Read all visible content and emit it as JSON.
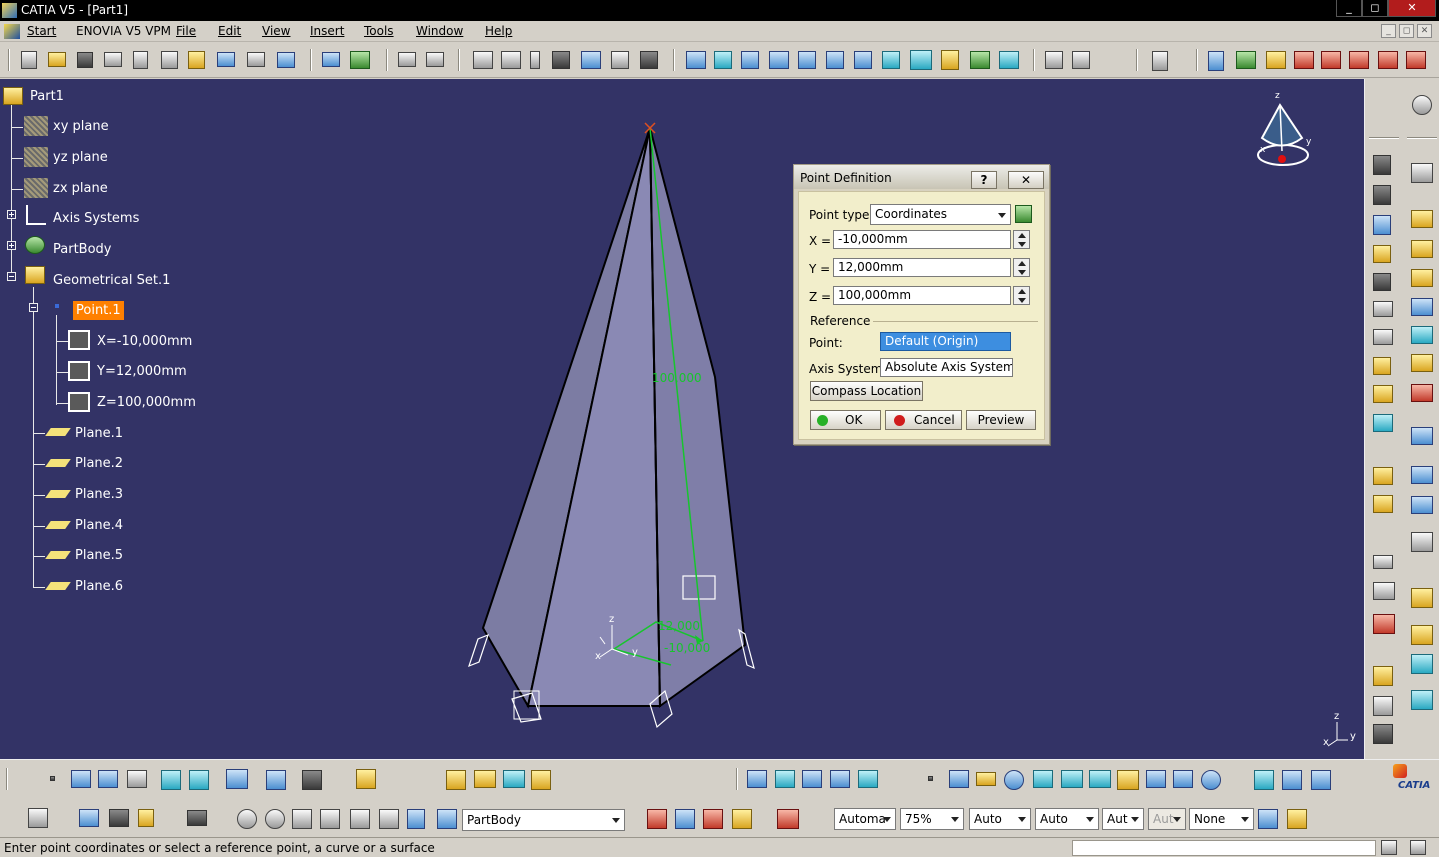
{
  "window": {
    "title": "CATIA V5 - [Part1]",
    "controls": {
      "minimize": "_",
      "restore": "◻",
      "close": "✕"
    },
    "mdi_controls": {
      "minimize": "_",
      "restore": "◻",
      "close": "✕"
    }
  },
  "menubar": {
    "items": [
      "Start",
      "ENOVIA V5 VPM",
      "File",
      "Edit",
      "View",
      "Insert",
      "Tools",
      "Window",
      "Help"
    ]
  },
  "tree": {
    "root": "Part1",
    "planes": [
      "xy plane",
      "yz plane",
      "zx plane"
    ],
    "axis_systems": "Axis Systems",
    "part_body": "PartBody",
    "geom_set": "Geometrical Set.1",
    "point": "Point.1",
    "coords": [
      "X=-10,000mm",
      "Y=12,000mm",
      "Z=100,000mm"
    ],
    "plane_items": [
      "Plane.1",
      "Plane.2",
      "Plane.3",
      "Plane.4",
      "Plane.5",
      "Plane.6"
    ]
  },
  "viewport": {
    "dim_labels": [
      "100,000",
      "12,000",
      "-10,000"
    ],
    "axis_labels": {
      "x": "x",
      "y": "y",
      "z": "z"
    }
  },
  "dialog": {
    "title": "Point Definition",
    "help_btn": "?",
    "close_btn": "✕",
    "point_type_label": "Point type:",
    "point_type_value": "Coordinates",
    "x_label": "X =",
    "x_value": "-10,000mm",
    "y_label": "Y =",
    "y_value": "12,000mm",
    "z_label": "Z =",
    "z_value": "100,000mm",
    "reference_label": "Reference",
    "point_label": "Point:",
    "point_value": "Default (Origin)",
    "axis_label": "Axis System:",
    "axis_value": "Absolute Axis System",
    "compass_btn": "Compass Location",
    "ok_btn": "OK",
    "cancel_btn": "Cancel",
    "preview_btn": "Preview"
  },
  "bottom_toolbar": {
    "body_combo": "PartBody",
    "combos": [
      "Automa",
      "75%",
      "Auto",
      "Auto",
      "Aut",
      "Aut",
      "None"
    ],
    "logo": "CATIA"
  },
  "status": {
    "message": "Enter point coordinates or select a reference point, a curve or a surface"
  },
  "colors": {
    "viewport_bg": "#333366",
    "selection_orange": "#ff8000",
    "dimension_green": "#17c52d",
    "dialog_bg": "#f2eecb"
  }
}
